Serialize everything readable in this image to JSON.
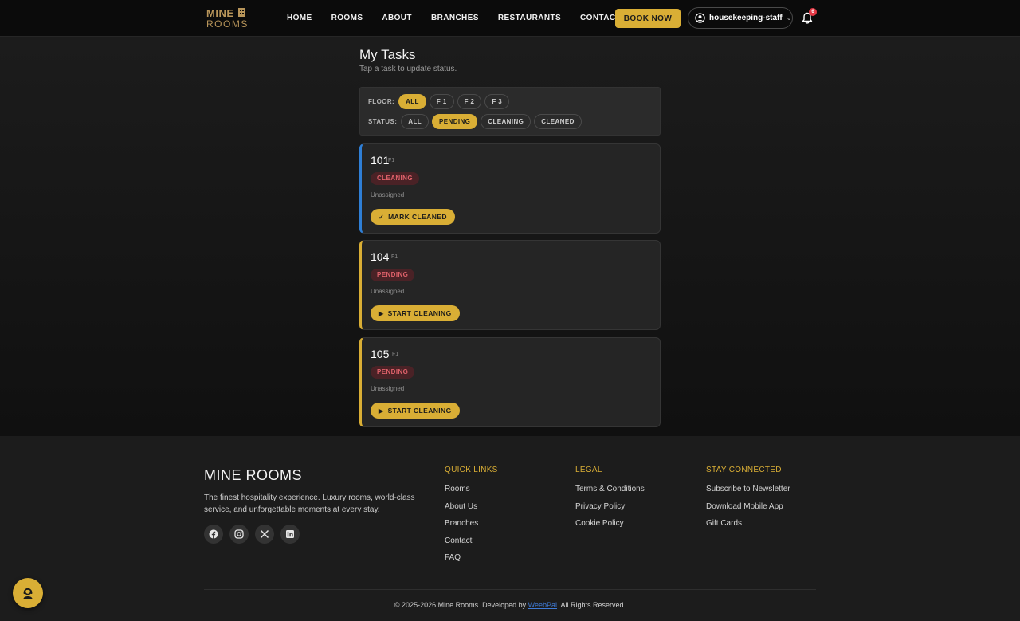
{
  "header": {
    "logo_line1": "MINE",
    "logo_line2": "ROOMS",
    "nav": [
      "HOME",
      "ROOMS",
      "ABOUT",
      "BRANCHES",
      "RESTAURANTS",
      "CONTACT"
    ],
    "book_label": "BOOK NOW",
    "user_name": "housekeeping-staff",
    "notification_count": "6"
  },
  "page": {
    "title": "My Tasks",
    "subtitle": "Tap a task to update status."
  },
  "filters": {
    "floor_label": "FLOOR:",
    "floor_options": [
      "ALL",
      "F 1",
      "F 2",
      "F 3"
    ],
    "floor_selected": "ALL",
    "status_label": "STATUS:",
    "status_options": [
      "ALL",
      "PENDING",
      "CLEANING",
      "CLEANED"
    ],
    "status_selected": "PENDING"
  },
  "tasks": [
    {
      "room": "101",
      "floor": "F1",
      "status": "CLEANING",
      "assignee": "Unassigned",
      "action": "MARK CLEANED"
    },
    {
      "room": "104",
      "floor": "F1",
      "status": "PENDING",
      "assignee": "Unassigned",
      "action": "START CLEANING"
    },
    {
      "room": "105",
      "floor": "F1",
      "status": "PENDING",
      "assignee": "Unassigned",
      "action": "START CLEANING"
    }
  ],
  "footer": {
    "brand": "MINE ROOMS",
    "description": "The finest hospitality experience. Luxury rooms, world-class service, and unforgettable moments at every stay.",
    "quick_links_title": "QUICK LINKS",
    "quick_links": [
      "Rooms",
      "About Us",
      "Branches",
      "Contact",
      "FAQ"
    ],
    "legal_title": "LEGAL",
    "legal_links": [
      "Terms & Conditions",
      "Privacy Policy",
      "Cookie Policy"
    ],
    "connected_title": "STAY CONNECTED",
    "connected_links": [
      "Subscribe to Newsletter",
      "Download Mobile App",
      "Gift Cards"
    ],
    "copyright_before": "© 2025-2026 Mine Rooms. Developed by ",
    "copyright_link": "WeebPal",
    "copyright_after": ". All Rights Reserved.",
    "social_icons": [
      "facebook-icon",
      "instagram-icon",
      "x-icon",
      "linkedin-icon"
    ]
  },
  "colors": {
    "accent": "#d9ae35",
    "cleaning_border": "#2f7fd6",
    "status_text": "#e0626b",
    "status_bg": "#4a2226",
    "link": "#3f7bd8"
  }
}
